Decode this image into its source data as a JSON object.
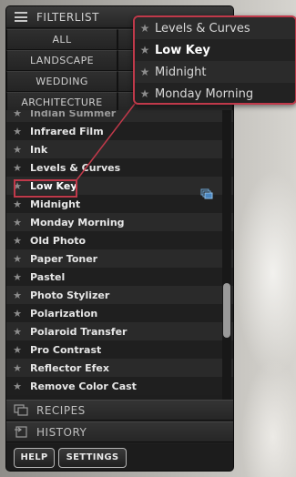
{
  "panel": {
    "title": "FILTERLIST"
  },
  "categories": [
    {
      "label": "ALL"
    },
    {
      "label": "LANDSCAPE"
    },
    {
      "label": "WEDDING"
    },
    {
      "label": "ARCHITECTURE"
    }
  ],
  "filters": [
    {
      "label": "Indian Summer"
    },
    {
      "label": "Infrared Film"
    },
    {
      "label": "Ink"
    },
    {
      "label": "Levels & Curves"
    },
    {
      "label": "Low Key"
    },
    {
      "label": "Midnight"
    },
    {
      "label": "Monday Morning"
    },
    {
      "label": "Old Photo"
    },
    {
      "label": "Paper Toner"
    },
    {
      "label": "Pastel"
    },
    {
      "label": "Photo Stylizer"
    },
    {
      "label": "Polarization"
    },
    {
      "label": "Polaroid Transfer"
    },
    {
      "label": "Pro Contrast"
    },
    {
      "label": "Reflector Efex"
    },
    {
      "label": "Remove Color Cast"
    }
  ],
  "selected_filter": "Low Key",
  "sections": {
    "recipes": "RECIPES",
    "history": "HISTORY"
  },
  "footer": {
    "help": "HELP",
    "settings": "SETTINGS"
  },
  "popout": [
    {
      "label": "Levels & Curves"
    },
    {
      "label": "Low Key"
    },
    {
      "label": "Midnight"
    },
    {
      "label": "Monday Morning"
    }
  ],
  "colors": {
    "callout": "#c0394a",
    "panel_bg": "#1e1e1e"
  }
}
